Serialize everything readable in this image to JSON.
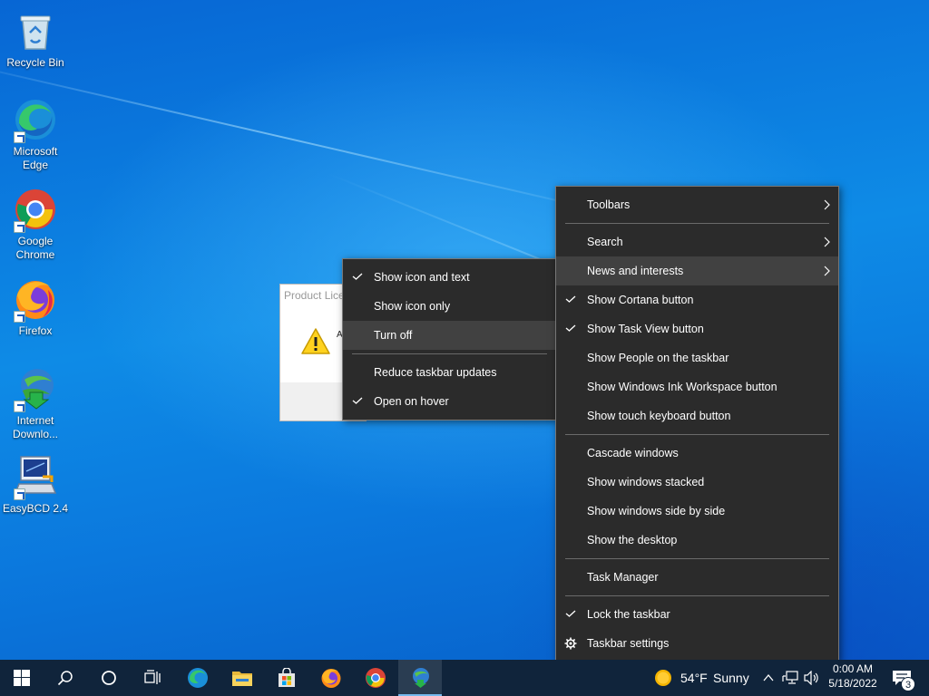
{
  "desktop": {
    "icons": [
      {
        "label": "Recycle Bin",
        "icon": "recycle-bin-icon"
      },
      {
        "label": "Microsoft Edge",
        "icon": "edge-icon"
      },
      {
        "label": "Google Chrome",
        "icon": "chrome-icon"
      },
      {
        "label": "Firefox",
        "icon": "firefox-icon"
      },
      {
        "label": "Internet Downlo...",
        "icon": "internet-download-manager-icon"
      },
      {
        "label": "EasyBCD 2.4",
        "icon": "easybcd-icon"
      }
    ]
  },
  "dialog": {
    "title": "Product Lice",
    "text": "A e n"
  },
  "submenu": {
    "items": [
      {
        "label": "Show icon and text",
        "checked": true
      },
      {
        "label": "Show icon only",
        "checked": false
      },
      {
        "label": "Turn off",
        "checked": false,
        "highlighted": true
      },
      {
        "label": "Reduce taskbar updates",
        "checked": false
      },
      {
        "label": "Open on hover",
        "checked": true
      }
    ]
  },
  "context_menu": {
    "items": [
      {
        "label": "Toolbars",
        "submenu": true
      },
      {
        "label": "Search",
        "submenu": true
      },
      {
        "label": "News and interests",
        "submenu": true,
        "highlighted": true
      },
      {
        "label": "Show Cortana button",
        "checked": true
      },
      {
        "label": "Show Task View button",
        "checked": true
      },
      {
        "label": "Show People on the taskbar",
        "checked": false
      },
      {
        "label": "Show Windows Ink Workspace button",
        "checked": false
      },
      {
        "label": "Show touch keyboard button",
        "checked": false
      },
      {
        "label": "Cascade windows"
      },
      {
        "label": "Show windows stacked"
      },
      {
        "label": "Show windows side by side"
      },
      {
        "label": "Show the desktop"
      },
      {
        "label": "Task Manager"
      },
      {
        "label": "Lock the taskbar",
        "checked": true
      },
      {
        "label": "Taskbar settings",
        "icon": "gear-icon"
      }
    ]
  },
  "taskbar": {
    "buttons": [
      "start-icon",
      "search-icon",
      "cortana-icon",
      "task-view-icon",
      "edge-icon",
      "file-explorer-icon",
      "microsoft-store-icon",
      "firefox-icon",
      "chrome-icon",
      "internet-download-manager-icon"
    ],
    "weather": {
      "temp": "54°F",
      "condition": "Sunny",
      "icon": "sun-icon"
    },
    "clock": {
      "time": "0:00 AM",
      "date": "5/18/2022"
    },
    "notifications": {
      "count": "3"
    }
  },
  "colors": {
    "menu_bg": "#2b2b2b",
    "menu_highlight": "#414141",
    "taskbar_bg": "#10243b",
    "desktop_blue": "#0b78dd"
  }
}
